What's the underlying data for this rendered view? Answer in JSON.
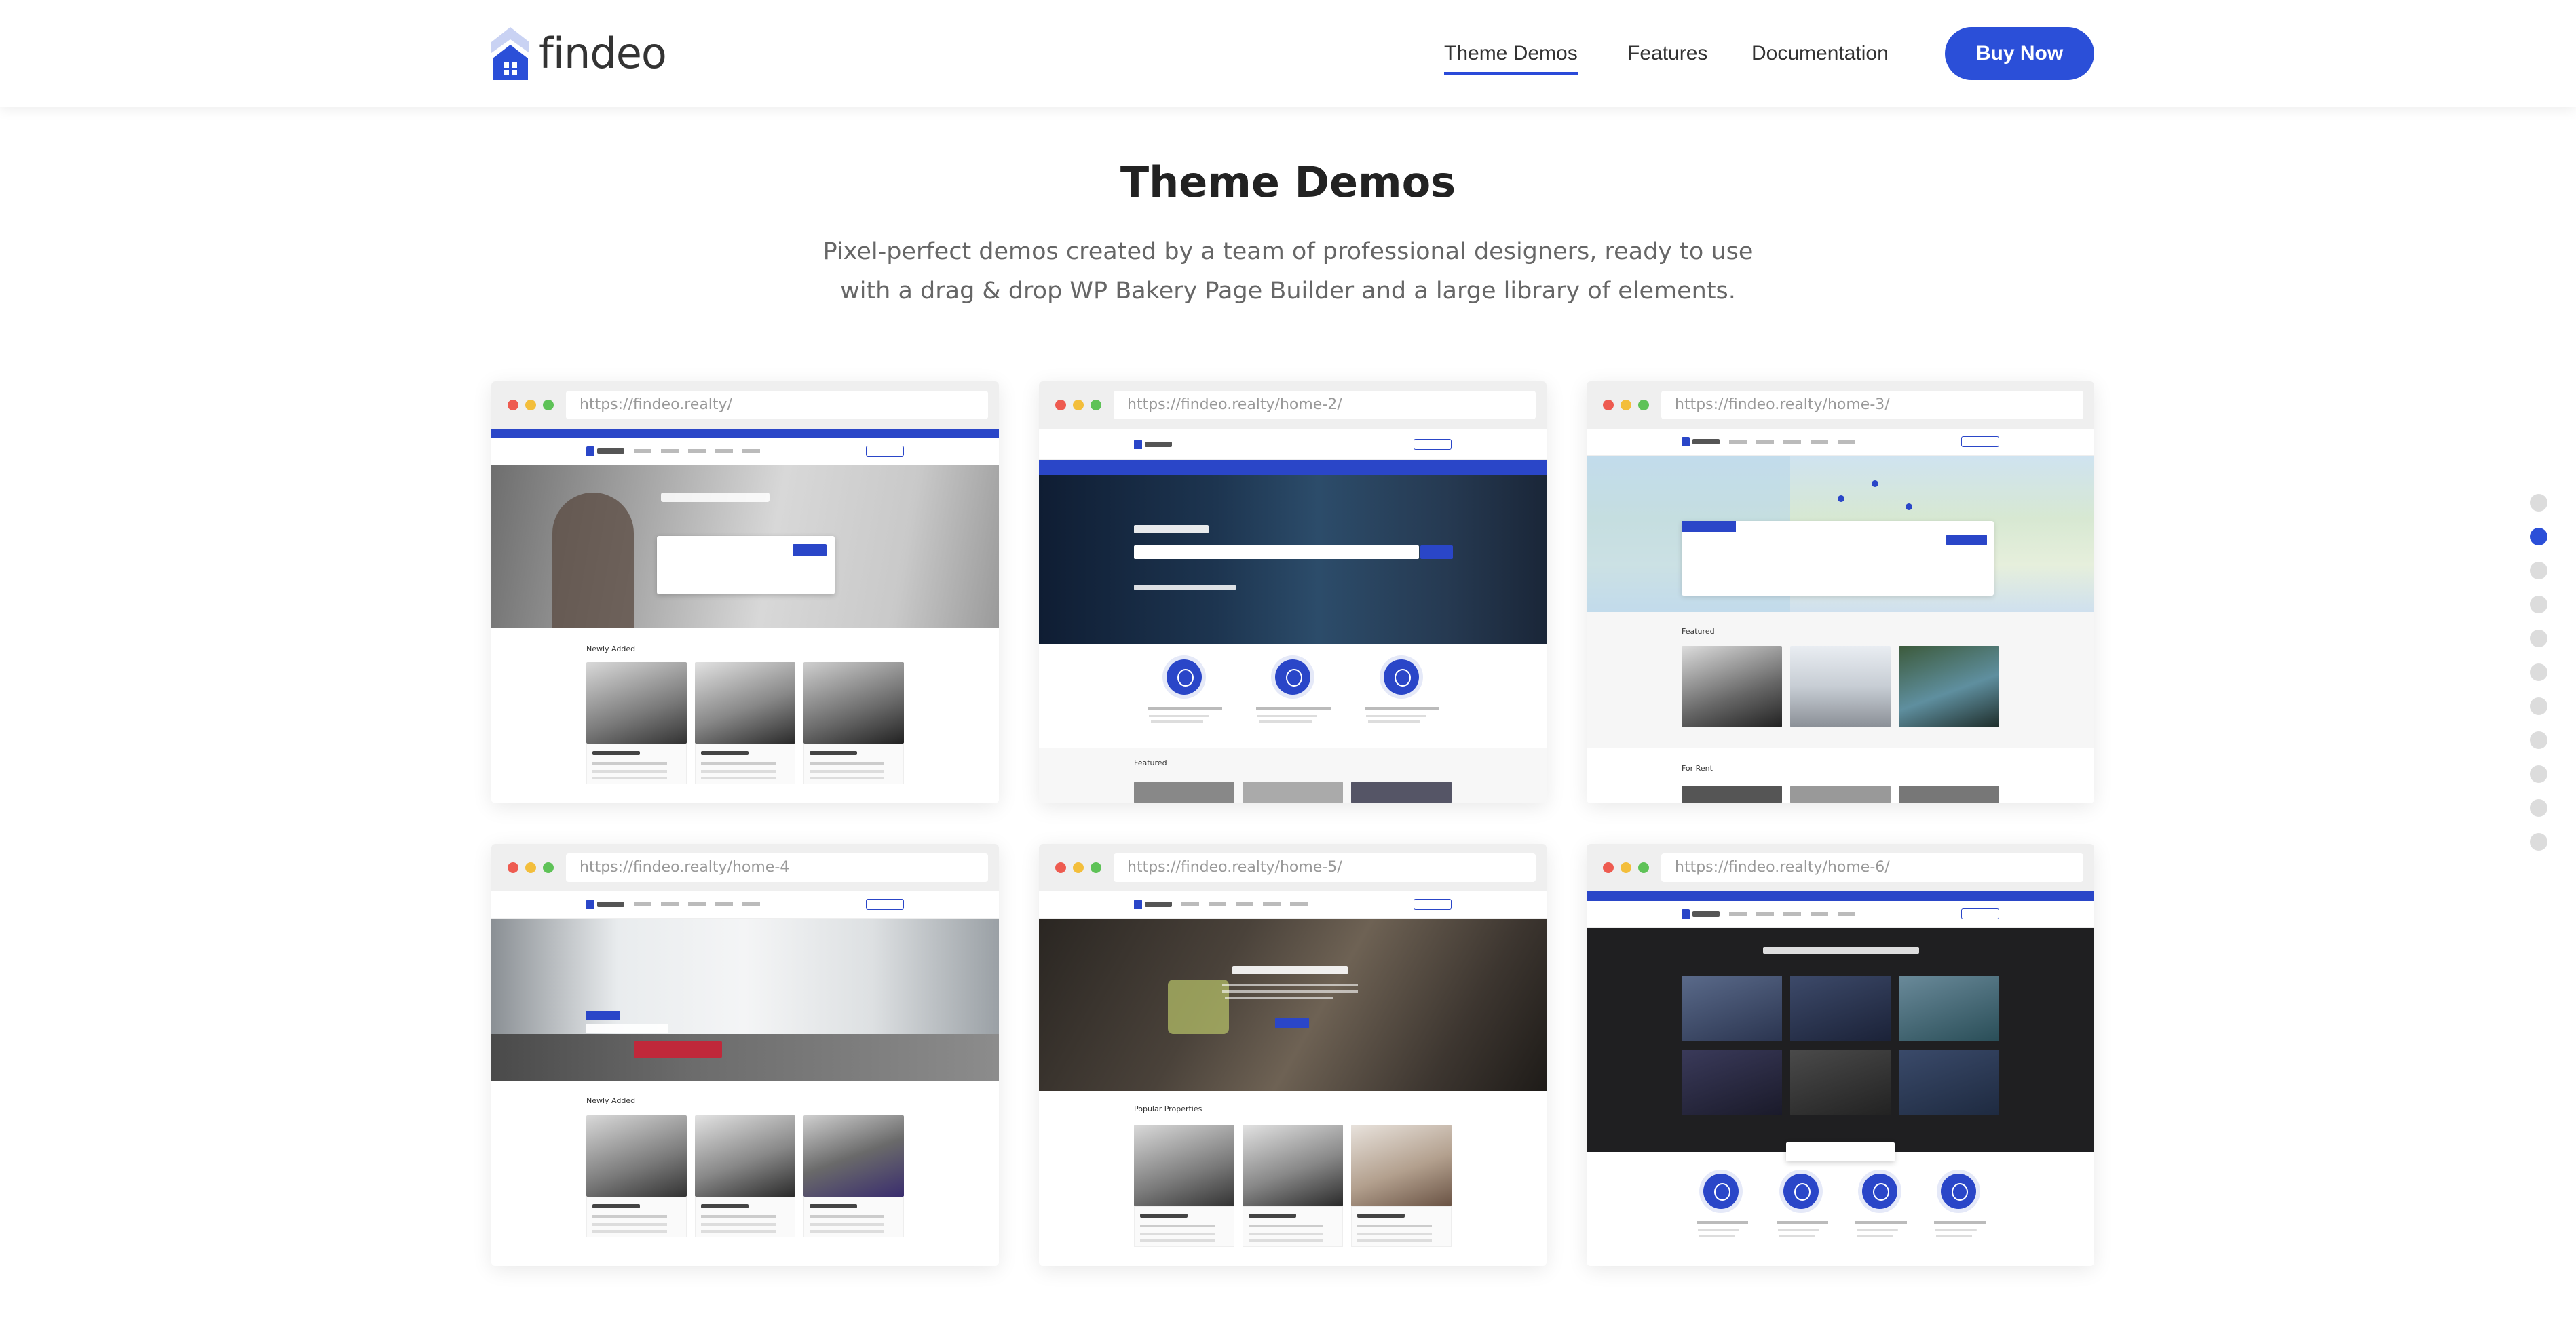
{
  "header": {
    "logo_text": "findeo",
    "nav": [
      {
        "label": "Theme Demos",
        "active": true
      },
      {
        "label": "Features",
        "active": false
      },
      {
        "label": "Documentation",
        "active": false
      }
    ],
    "buy_label": "Buy Now",
    "accent_color": "#2b4fd8"
  },
  "section": {
    "title": "Theme Demos",
    "description": "Pixel-perfect demos created by a team of professional designers, ready to use with a drag & drop WP Bakery Page Builder and a large library of elements."
  },
  "demos": [
    {
      "url": "https://findeo.realty/"
    },
    {
      "url": "https://findeo.realty/home-2/"
    },
    {
      "url": "https://findeo.realty/home-3/"
    },
    {
      "url": "https://findeo.realty/home-4"
    },
    {
      "url": "https://findeo.realty/home-5/"
    },
    {
      "url": "https://findeo.realty/home-6/"
    }
  ],
  "side_pagination": {
    "count": 11,
    "active_index": 1
  },
  "icons": {
    "logo": "house-icon",
    "browser_dots": [
      "close-dot",
      "minimize-dot",
      "maximize-dot"
    ]
  }
}
